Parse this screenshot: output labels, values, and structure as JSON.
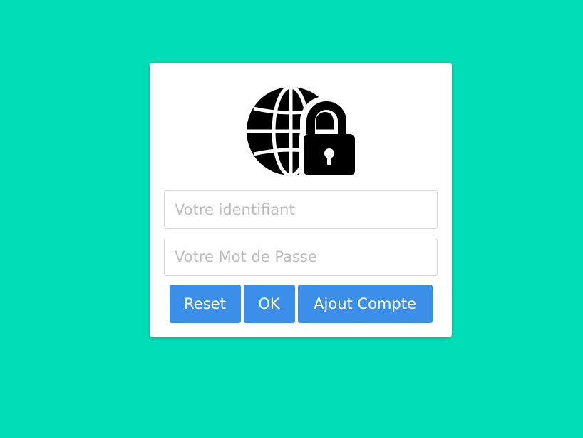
{
  "login": {
    "icon": "globe-lock-icon",
    "username_placeholder": "Votre identifiant",
    "password_placeholder": "Votre Mot de Passe",
    "buttons": {
      "reset": "Reset",
      "ok": "OK",
      "add_account": "Ajout Compte"
    }
  },
  "colors": {
    "background": "#00dcb5",
    "button": "#3b8fe8",
    "card": "#ffffff"
  }
}
